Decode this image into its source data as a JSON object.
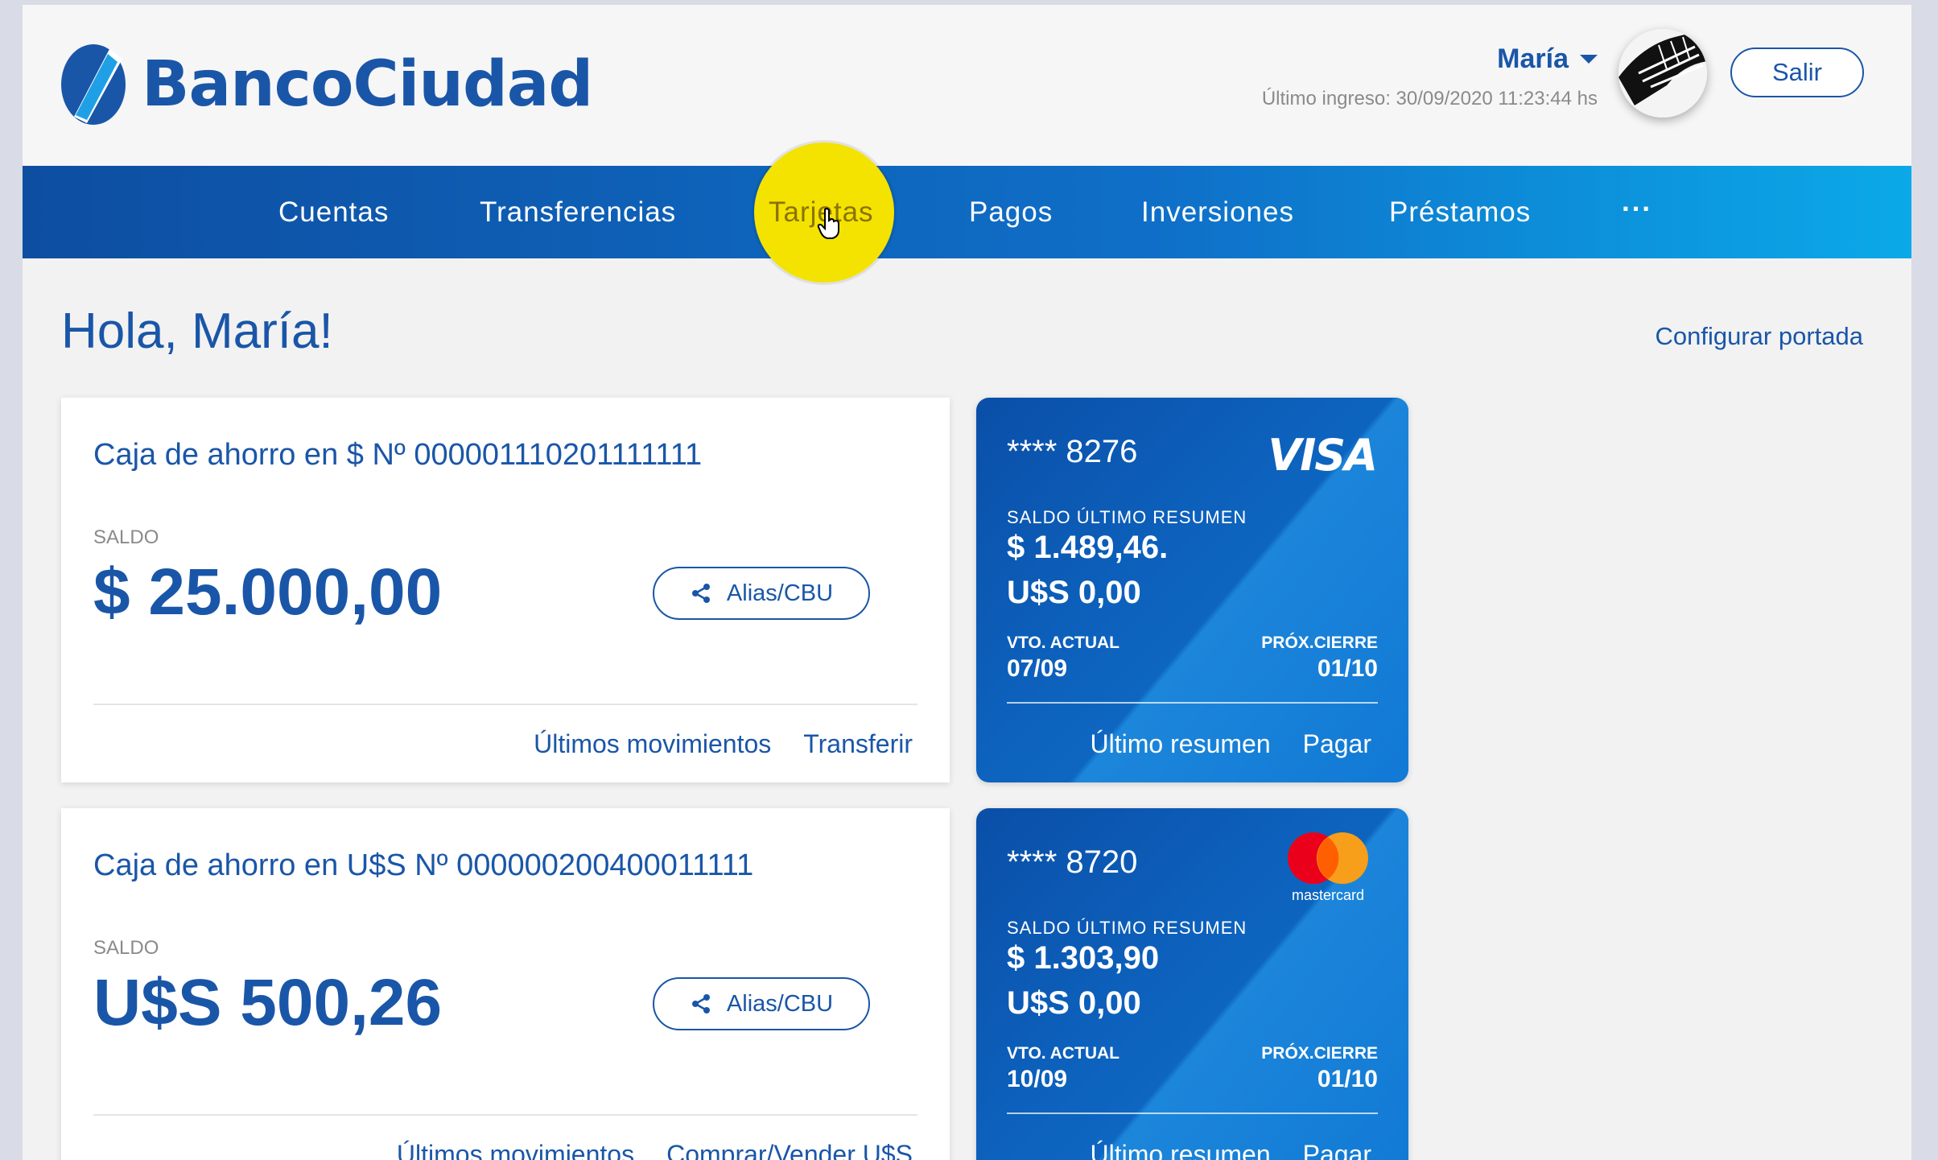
{
  "header": {
    "logo_text": "BancoCiudad",
    "user_name": "María",
    "last_login": "Último ingreso: 30/09/2020 11:23:44 hs",
    "logout_label": "Salir"
  },
  "nav": {
    "items": [
      {
        "label": "Cuentas"
      },
      {
        "label": "Transferencias"
      },
      {
        "label": "Tarjetas"
      },
      {
        "label": "Pagos"
      },
      {
        "label": "Inversiones"
      },
      {
        "label": "Préstamos"
      },
      {
        "label": "···"
      }
    ]
  },
  "main": {
    "greeting": "Hola, María!",
    "configure_label": "Configurar portada"
  },
  "accounts": [
    {
      "title": "Caja de ahorro en $ Nº 000001110201111111",
      "saldo_label": "SALDO",
      "saldo": "$ 25.000,00",
      "alias_label": "Alias/CBU",
      "link1": "Últimos movimientos",
      "link2": "Transferir"
    },
    {
      "title": "Caja de ahorro en U$S Nº 000000200400011111",
      "saldo_label": "SALDO",
      "saldo": "U$S 500,26",
      "alias_label": "Alias/CBU",
      "link1": "Últimos movimientos",
      "link2": "Comprar/Vender U$S"
    }
  ],
  "cards": [
    {
      "number": "**** 8276",
      "brand": "VISA",
      "saldo_label": "SALDO ÚLTIMO RESUMEN",
      "saldo_pesos": "$ 1.489,46.",
      "saldo_dolares": "U$S 0,00",
      "vto_label": "VTO. ACTUAL",
      "vto": "07/09",
      "cierre_label": "PRÓX.CIERRE",
      "cierre": "01/10",
      "link1": "Último resumen",
      "link2": "Pagar"
    },
    {
      "number": "**** 8720",
      "brand": "mastercard",
      "saldo_label": "SALDO ÚLTIMO RESUMEN",
      "saldo_pesos": "$ 1.303,90",
      "saldo_dolares": "U$S 0,00",
      "vto_label": "VTO. ACTUAL",
      "vto": "10/09",
      "cierre_label": "PRÓX.CIERRE",
      "cierre": "01/10",
      "link1": "Último resumen",
      "link2": "Pagar"
    }
  ],
  "colors": {
    "brand_blue": "#1a56a8",
    "nav_gradient_start": "#0d4ea1",
    "nav_gradient_end": "#0ba9e8",
    "click_highlight": "#f4e300",
    "mastercard_red": "#eb001b",
    "mastercard_orange": "#f79e1b"
  }
}
